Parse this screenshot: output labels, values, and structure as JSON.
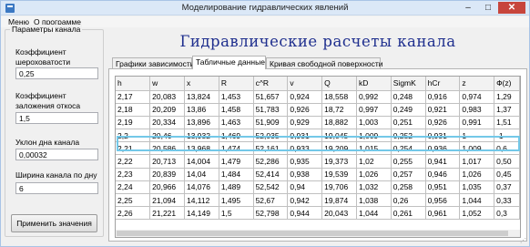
{
  "window": {
    "title": "Моделирование гидравлических явлений",
    "controls": {
      "minimize": "–",
      "maximize": "□",
      "close": "✕"
    }
  },
  "menu": [
    "Меню",
    "О программе"
  ],
  "params": {
    "group_title": "Параметры канала",
    "fields": [
      {
        "label_lines": [
          "Коэффициент",
          "шероховатости"
        ],
        "value": "0,25"
      },
      {
        "label_lines": [
          "Коэффициент",
          "заложения откоса"
        ],
        "value": "1,5"
      },
      {
        "label_lines": [
          "Уклон дна канала"
        ],
        "value": "0,00032"
      },
      {
        "label_lines": [
          "Ширина канала по дну"
        ],
        "value": "6"
      }
    ],
    "apply_label": "Применить значения"
  },
  "main_title": "Гидравлические расчеты канала",
  "tabs": [
    "Графики зависимости",
    "Табличные данные",
    "Кривая свободной поверхности"
  ],
  "active_tab": 1,
  "table": {
    "columns": [
      "h",
      "w",
      "x",
      "R",
      "c^R",
      "v",
      "Q",
      "kD",
      "SigmK",
      "hCr",
      "z",
      "Ф(z)"
    ],
    "rows": [
      [
        "2,17",
        "20,083",
        "13,824",
        "1,453",
        "51,657",
        "0,924",
        "18,558",
        "0,992",
        "0,248",
        "0,916",
        "0,974",
        "1,29"
      ],
      [
        "2,18",
        "20,209",
        "13,86",
        "1,458",
        "51,783",
        "0,926",
        "18,72",
        "0,997",
        "0,249",
        "0,921",
        "0,983",
        "1,37"
      ],
      [
        "2,19",
        "20,334",
        "13,896",
        "1,463",
        "51,909",
        "0,929",
        "18,882",
        "1,003",
        "0,251",
        "0,926",
        "0,991",
        "1,51"
      ],
      [
        "2,2",
        "20,46",
        "13,932",
        "1,469",
        "52,035",
        "0,931",
        "19,045",
        "1,009",
        "0,252",
        "0,931",
        "1",
        "-1"
      ],
      [
        "2,21",
        "20,586",
        "13,968",
        "1,474",
        "52,161",
        "0,933",
        "19,209",
        "1,015",
        "0,254",
        "0,936",
        "1,009",
        "0,6"
      ],
      [
        "2,22",
        "20,713",
        "14,004",
        "1,479",
        "52,286",
        "0,935",
        "19,373",
        "1,02",
        "0,255",
        "0,941",
        "1,017",
        "0,50"
      ],
      [
        "2,23",
        "20,839",
        "14,04",
        "1,484",
        "52,414",
        "0,938",
        "19,539",
        "1,026",
        "0,257",
        "0,946",
        "1,026",
        "0,45"
      ],
      [
        "2,24",
        "20,966",
        "14,076",
        "1,489",
        "52,542",
        "0,94",
        "19,706",
        "1,032",
        "0,258",
        "0,951",
        "1,035",
        "0,37"
      ],
      [
        "2,25",
        "21,094",
        "14,112",
        "1,495",
        "52,67",
        "0,942",
        "19,874",
        "1,038",
        "0,26",
        "0,956",
        "1,044",
        "0,33"
      ],
      [
        "2,26",
        "21,221",
        "14,149",
        "1,5",
        "52,798",
        "0,944",
        "20,043",
        "1,044",
        "0,261",
        "0,961",
        "1,052",
        "0,3"
      ]
    ],
    "selected_row": 3
  }
}
